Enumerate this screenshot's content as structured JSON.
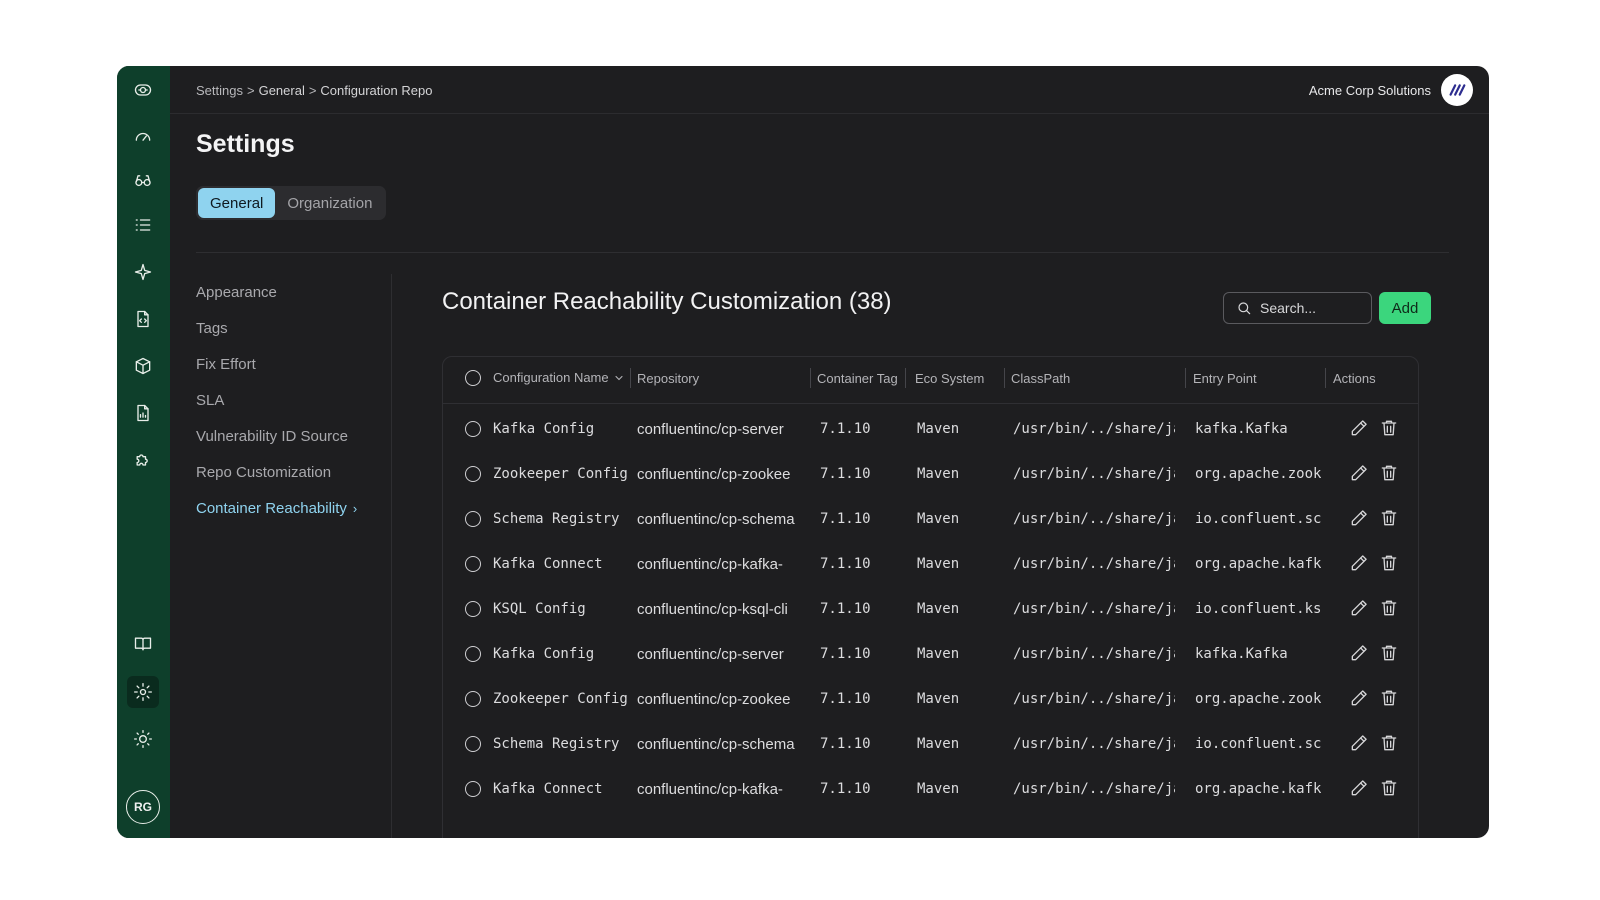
{
  "breadcrumb": [
    "Settings",
    "General",
    "Configuration Repo"
  ],
  "breadcrumb_sep": ">",
  "org": {
    "name": "Acme Corp Solutions",
    "logo_icon": "acme-logo-icon"
  },
  "page": {
    "title": "Settings"
  },
  "tabs": [
    {
      "label": "General",
      "active": true
    },
    {
      "label": "Organization",
      "active": false
    }
  ],
  "rail": {
    "icons": [
      "app-logo-icon",
      "dashboard-gauge-icon",
      "glasses-icon",
      "list-icon",
      "sparkle-icon",
      "code-file-icon",
      "package-icon",
      "file-chart-icon",
      "puzzle-icon",
      "book-icon",
      "gear-icon",
      "sun-icon"
    ],
    "avatar_initials": "RG"
  },
  "subnav": [
    {
      "label": "Appearance"
    },
    {
      "label": "Tags"
    },
    {
      "label": "Fix Effort"
    },
    {
      "label": "SLA"
    },
    {
      "label": "Vulnerability ID Source"
    },
    {
      "label": "Repo Customization"
    },
    {
      "label": "Container Reachability",
      "active": true,
      "chevron": "›"
    }
  ],
  "content": {
    "title": "Container Reachability Customization (38)",
    "search_placeholder": "Search...",
    "add_label": "Add"
  },
  "table": {
    "columns": [
      "Configuration Name",
      "Repository",
      "Container Tag",
      "Eco System",
      "ClassPath",
      "Entry Point",
      "Actions"
    ],
    "rows": [
      [
        "Kafka Config",
        "confluentinc/cp-server",
        "7.1.10",
        "Maven",
        "/usr/bin/../share/ja",
        "kafka.Kafka"
      ],
      [
        "Zookeeper Config",
        "confluentinc/cp-zookee",
        "7.1.10",
        "Maven",
        "/usr/bin/../share/ja",
        "org.apache.zook"
      ],
      [
        "Schema Registry",
        "confluentinc/cp-schema",
        "7.1.10",
        "Maven",
        "/usr/bin/../share/ja",
        "io.confluent.sc"
      ],
      [
        "Kafka Connect",
        "confluentinc/cp-kafka-",
        "7.1.10",
        "Maven",
        "/usr/bin/../share/ja",
        "org.apache.kafk"
      ],
      [
        "KSQL Config",
        "confluentinc/cp-ksql-cli",
        "7.1.10",
        "Maven",
        "/usr/bin/../share/ja",
        "io.confluent.ks"
      ],
      [
        "Kafka Config",
        "confluentinc/cp-server",
        "7.1.10",
        "Maven",
        "/usr/bin/../share/ja",
        "kafka.Kafka"
      ],
      [
        "Zookeeper Config",
        "confluentinc/cp-zookee",
        "7.1.10",
        "Maven",
        "/usr/bin/../share/ja",
        "org.apache.zook"
      ],
      [
        "Schema Registry",
        "confluentinc/cp-schema",
        "7.1.10",
        "Maven",
        "/usr/bin/../share/ja",
        "io.confluent.sc"
      ],
      [
        "Kafka Connect",
        "confluentinc/cp-kafka-",
        "7.1.10",
        "Maven",
        "/usr/bin/../share/ja",
        "org.apache.kafk"
      ]
    ],
    "row_actions": [
      "edit-pencil-icon",
      "trash-icon"
    ]
  },
  "colors": {
    "rail": "#0e3f2b",
    "background": "#1e1e20",
    "accent_tab": "#8fd3ef",
    "add_button": "#3bd67d"
  }
}
